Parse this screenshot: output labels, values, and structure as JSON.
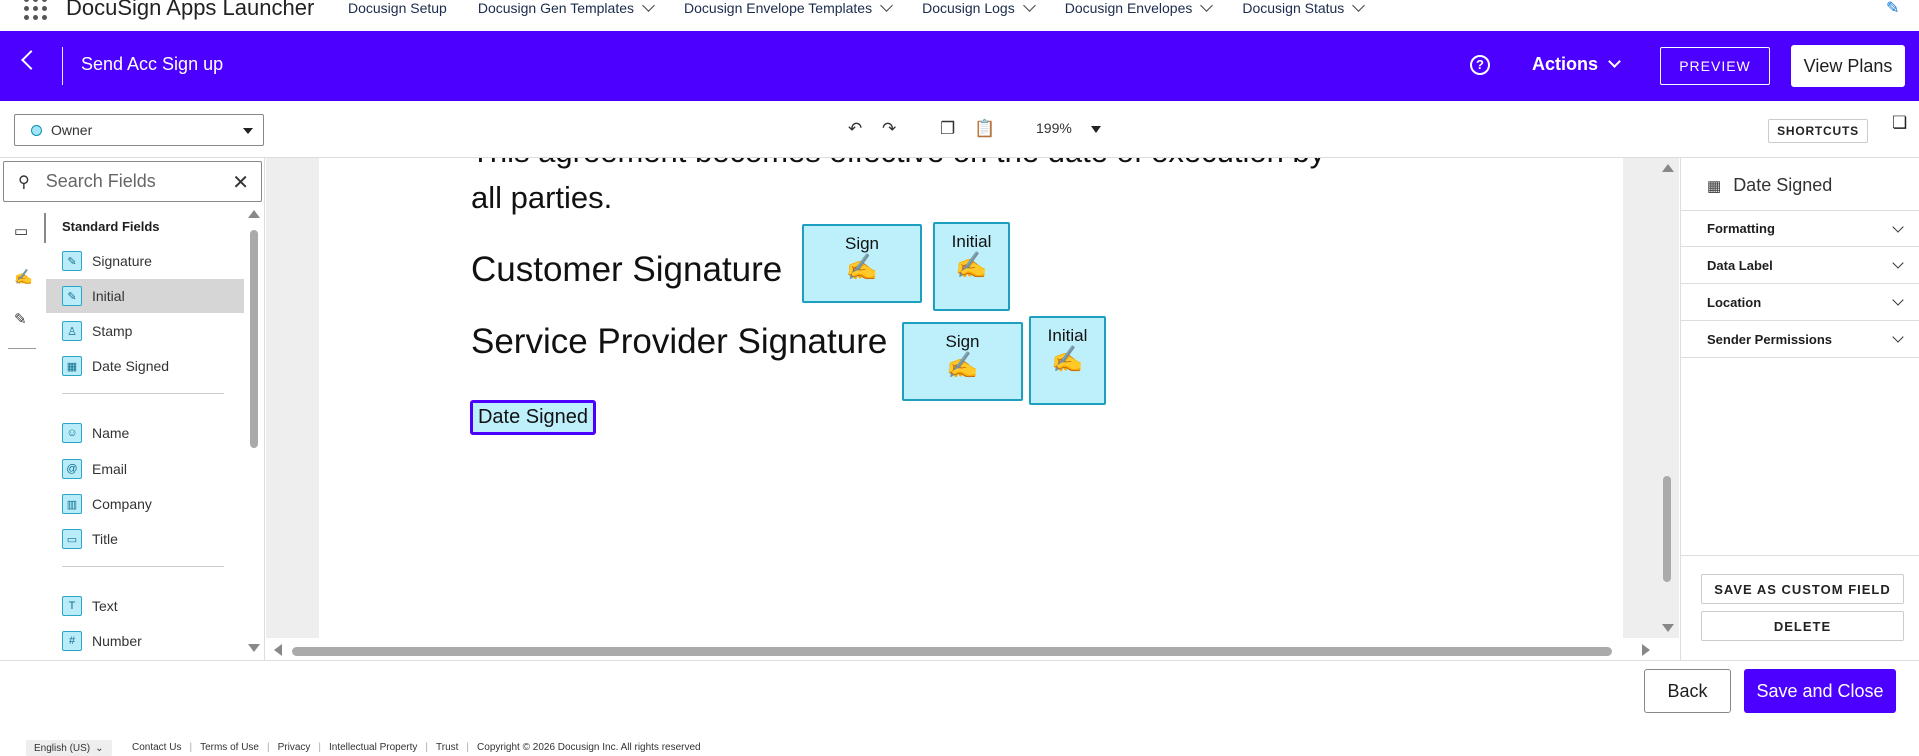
{
  "top_nav": {
    "app_name": "DocuSign Apps Launcher",
    "items": [
      {
        "label": "Docusign Setup",
        "has_menu": false
      },
      {
        "label": "Docusign Gen Templates",
        "has_menu": true
      },
      {
        "label": "Docusign Envelope Templates",
        "has_menu": true
      },
      {
        "label": "Docusign Logs",
        "has_menu": true
      },
      {
        "label": "Docusign Envelopes",
        "has_menu": true
      },
      {
        "label": "Docusign Status",
        "has_menu": true
      }
    ],
    "edit_icon": "pencil-icon"
  },
  "header": {
    "title": "Send Acc Sign up",
    "actions_label": "Actions",
    "preview_label": "PREVIEW",
    "view_plans_label": "View Plans",
    "accent_color": "#4c00ff"
  },
  "toolbar": {
    "recipient": "Owner",
    "zoom": "199%",
    "shortcuts_label": "SHORTCUTS"
  },
  "left_panel": {
    "search_placeholder": "Search Fields",
    "section_title": "Standard Fields",
    "fields": [
      {
        "label": "Signature",
        "icon": "pen-icon",
        "glyph": "✎"
      },
      {
        "label": "Initial",
        "icon": "pen-icon",
        "glyph": "✎",
        "selected": true
      },
      {
        "label": "Stamp",
        "icon": "stamp-icon",
        "glyph": "♙"
      },
      {
        "label": "Date Signed",
        "icon": "calendar-icon",
        "glyph": "▦"
      },
      {
        "label": "Name",
        "icon": "person-icon",
        "glyph": "☺"
      },
      {
        "label": "Email",
        "icon": "at-icon",
        "glyph": "@"
      },
      {
        "label": "Company",
        "icon": "building-icon",
        "glyph": "▥"
      },
      {
        "label": "Title",
        "icon": "briefcase-icon",
        "glyph": "▭"
      },
      {
        "label": "Text",
        "icon": "text-icon",
        "glyph": "T"
      },
      {
        "label": "Number",
        "icon": "hash-icon",
        "glyph": "#"
      }
    ]
  },
  "document": {
    "line1": "This agreement becomes effective on the date of execution by",
    "line2": "all parties.",
    "customer_label": "Customer Signature",
    "provider_label": "Service Provider Signature",
    "sign_label": "Sign",
    "initial_label": "Initial",
    "date_signed_label": "Date Signed"
  },
  "right_panel": {
    "title": "Date Signed",
    "sections": [
      "Formatting",
      "Data Label",
      "Location",
      "Sender Permissions"
    ],
    "save_custom_label": "SAVE AS CUSTOM FIELD",
    "delete_label": "DELETE"
  },
  "bottom_bar": {
    "back_label": "Back",
    "save_close_label": "Save and Close"
  },
  "footer": {
    "language": "English (US)",
    "links": [
      "Contact Us",
      "Terms of Use",
      "Privacy",
      "Intellectual Property",
      "Trust"
    ],
    "copyright": "Copyright © 2026 Docusign Inc. All rights reserved"
  }
}
